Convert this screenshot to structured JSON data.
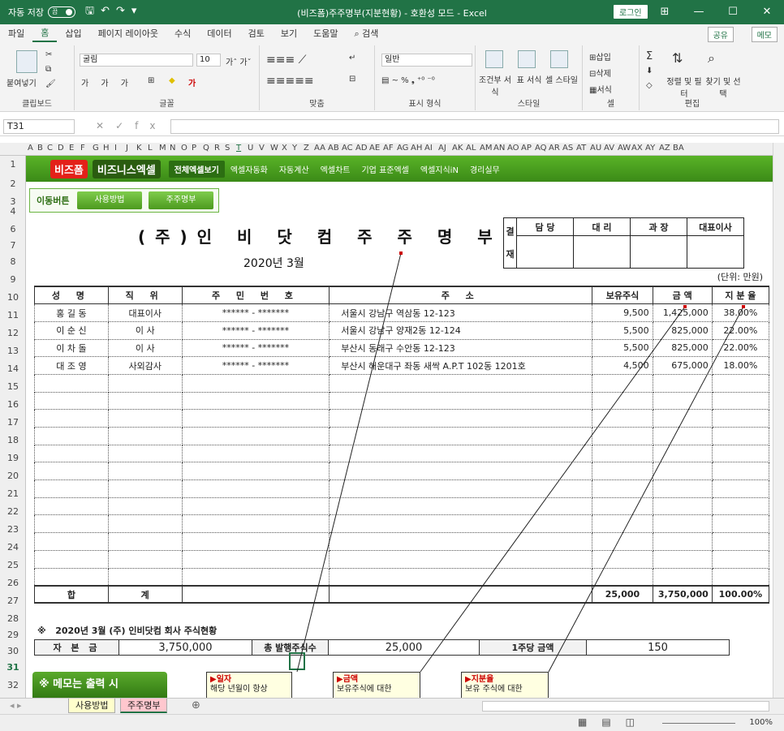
{
  "window": {
    "autosave": "자동 저장",
    "toggle": "끔",
    "title": "(비즈폼)주주명부(지분현황) - 호환성 모드 - Excel",
    "login": "로그인",
    "min": "—",
    "max": "☐",
    "close": "✕",
    "layout": "⊞"
  },
  "menu": {
    "tabs": [
      "파일",
      "홈",
      "삽입",
      "페이지 레이아웃",
      "수식",
      "데이터",
      "검토",
      "보기",
      "도움말"
    ],
    "search": "검색",
    "share": "공유",
    "memo": "메모"
  },
  "ribbon": {
    "paste": "붙여넣기",
    "clipboard": "클립보드",
    "font_name": "굴림",
    "font_size": "10",
    "font_group": "글꼴",
    "align_group": "맞춤",
    "number_format": "일반",
    "number_group": "표시 형식",
    "cond": "조건부 서식",
    "table": "표 서식",
    "cell_style": "셀 스타일",
    "style_group": "스타일",
    "insert": "삽입",
    "delete": "삭제",
    "format": "서식",
    "cell_group": "셀",
    "sort": "정렬 및 필터",
    "find": "찾기 및 선택",
    "edit_group": "편집"
  },
  "formula": {
    "name_box": "T31",
    "fx": "fx",
    "cancel": "✕",
    "enter": "✓"
  },
  "columns": [
    "A",
    "B",
    "C",
    "D",
    "E",
    "F",
    "G",
    "H",
    "I",
    "J",
    "K",
    "L",
    "M",
    "N",
    "O",
    "P",
    "Q",
    "R",
    "S",
    "T",
    "U",
    "V",
    "W",
    "X",
    "Y",
    "Z",
    "AA",
    "AB",
    "AC",
    "AD",
    "AE",
    "AF",
    "AG",
    "AH",
    "AI",
    "AJ",
    "AK",
    "AL",
    "AM",
    "AN",
    "AO",
    "AP",
    "AQ",
    "AR",
    "AS",
    "AT",
    "AU",
    "AV",
    "AW",
    "AX",
    "AY",
    "AZ",
    "BA"
  ],
  "rows": [
    "1",
    "2",
    "3",
    "4",
    "6",
    "7",
    "8",
    "9",
    "10",
    "11",
    "12",
    "13",
    "14",
    "15",
    "16",
    "17",
    "18",
    "19",
    "20",
    "21",
    "22",
    "23",
    "24",
    "25",
    "26",
    "27",
    "28",
    "29",
    "30",
    "31",
    "32"
  ],
  "bizbar": {
    "logo1": "비즈폼",
    "logo2": "비즈니스엑셀",
    "nav": [
      "전체엑셀보기",
      "엑셀자동화",
      "자동계산",
      "엑셀차트",
      "기업 표준엑셀",
      "엑셀지식iN",
      "경리실무"
    ]
  },
  "move": {
    "label": "이동버튼",
    "btn1": "사용방법",
    "btn2": "주주명부"
  },
  "doc": {
    "title": "(주)인 비 닷 컴  주 주 명 부",
    "date": "2020년  3월",
    "unit": "(단위: 만원)",
    "approval": {
      "side1": "결",
      "side2": "재",
      "cols": [
        "담  당",
        "대  리",
        "과  장",
        "대표이사"
      ]
    },
    "headers": [
      "성  명",
      "직  위",
      "주 민 번 호",
      "주            소",
      "보유주식",
      "금  액",
      "지 분 율"
    ],
    "rows": [
      {
        "name": "홍 길 동",
        "pos": "대표이사",
        "id": "****** - *******",
        "addr": "서울시 강남구 역삼동 12-123",
        "shares": "9,500",
        "amount": "1,425,000",
        "ratio": "38.00%"
      },
      {
        "name": "이 순 신",
        "pos": "이   사",
        "id": "****** - *******",
        "addr": "서울시 강남구 양재2동 12-124",
        "shares": "5,500",
        "amount": "825,000",
        "ratio": "22.00%"
      },
      {
        "name": "이 차 돌",
        "pos": "이   사",
        "id": "****** - *******",
        "addr": "부산시 동래구 수안동 12-123",
        "shares": "5,500",
        "amount": "825,000",
        "ratio": "22.00%"
      },
      {
        "name": "대 조 영",
        "pos": "사외감사",
        "id": "****** - *******",
        "addr": "부산시 해운대구 좌동 새싹 A.P.T 102동 1201호",
        "shares": "4,500",
        "amount": "675,000",
        "ratio": "18.00%"
      }
    ],
    "total": {
      "label1": "합",
      "label2": "계",
      "shares": "25,000",
      "amount": "3,750,000",
      "ratio": "100.00%"
    },
    "summary": {
      "mark": "※",
      "title": "2020년 3월   (주) 인비닷컴 회사 주식현황",
      "k1": "자 본 금",
      "v1": "3,750,000",
      "k2": "총 발행주식수",
      "v2": "25,000",
      "k3": "1주당 금액",
      "v3": "150"
    },
    "memo_left": "※ 메모는 출력 시",
    "notes": [
      {
        "t": "▶일자",
        "b": "해당 년월이 항상"
      },
      {
        "t": "▶금액",
        "b": "보유주식에 대한"
      },
      {
        "t": "▶지분율",
        "b": "보유 주식에 대한"
      }
    ]
  },
  "sheets": {
    "tab1": "사용방법",
    "tab2": "주주명부",
    "add": "⊕"
  },
  "status": {
    "zoom": "100%"
  }
}
